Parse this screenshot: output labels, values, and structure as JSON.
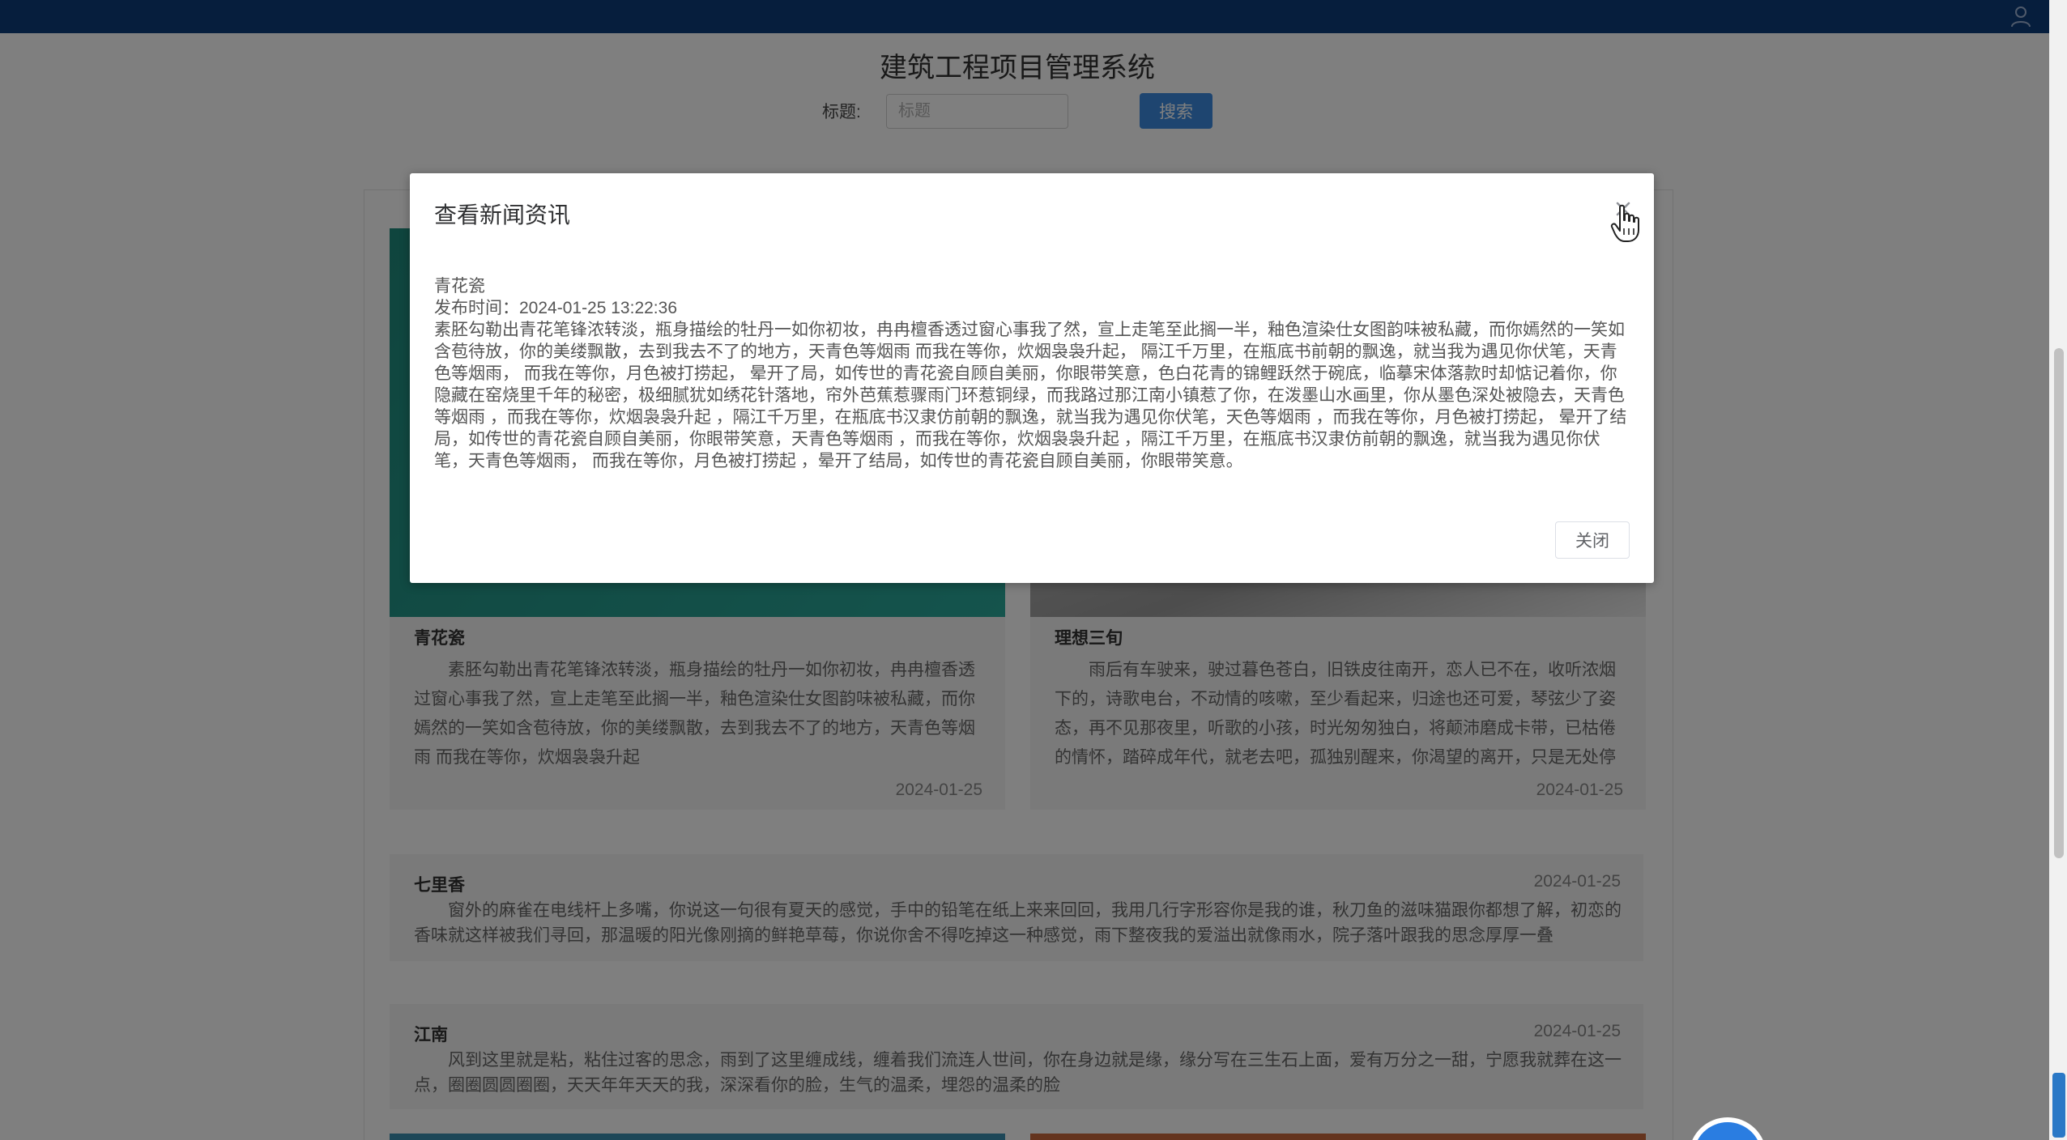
{
  "header": {
    "user_icon": "user-icon"
  },
  "page": {
    "title": "建筑工程项目管理系统",
    "search_label": "标题:",
    "search_placeholder": "标题",
    "search_button": "搜索"
  },
  "cards": [
    {
      "title": "青花瓷",
      "summary": "素胚勾勒出青花笔锋浓转淡，瓶身描绘的牡丹一如你初妆，冉冉檀香透过窗心事我了然，宣上走笔至此搁一半，釉色渲染仕女图韵味被私藏，而你嫣然的一笑如含苞待放，你的美缕飘散，去到我去不了的地方，天青色等烟雨 而我在等你，炊烟袅袅升起",
      "date": "2024-01-25"
    },
    {
      "title": "理想三旬",
      "summary": "雨后有车驶来，驶过暮色苍白，旧铁皮往南开，恋人已不在，收听浓烟下的，诗歌电台，不动情的咳嗽，至少看起来，归途也还可爱，琴弦少了姿态，再不见那夜里，听歌的小孩，时光匆匆独白，将颠沛磨成卡带，已枯倦的情怀，踏碎成年代，就老去吧，孤独别醒来，你渴望的离开，只是无处停",
      "date": "2024-01-25"
    }
  ],
  "rows": [
    {
      "title": "七里香",
      "date": "2024-01-25",
      "summary": "窗外的麻雀在电线杆上多嘴，你说这一句很有夏天的感觉，手中的铅笔在纸上来来回回，我用几行字形容你是我的谁，秋刀鱼的滋味猫跟你都想了解，初恋的香味就这样被我们寻回，那温暖的阳光像刚摘的鲜艳草莓，你说你舍不得吃掉这一种感觉，雨下整夜我的爱溢出就像雨水，院子落叶跟我的思念厚厚一叠"
    },
    {
      "title": "江南",
      "date": "2024-01-25",
      "summary": "风到这里就是粘，粘住过客的思念，雨到了这里缠成线，缠着我们流连人世间，你在身边就是缘，缘分写在三生石上面，爱有万分之一甜，宁愿我就葬在这一点，圈圈圆圆圈圈，天天年年天天的我，深深看你的脸，生气的温柔，埋怨的温柔的脸"
    }
  ],
  "dialog": {
    "title": "查看新闻资讯",
    "news_title": "青花瓷",
    "publish_time": "发布时间：2024-01-25 13:22:36",
    "content": "素胚勾勒出青花笔锋浓转淡，瓶身描绘的牡丹一如你初妆，冉冉檀香透过窗心事我了然，宣上走笔至此搁一半，釉色渲染仕女图韵味被私藏，而你嫣然的一笑如含苞待放，你的美缕飘散，去到我去不了的地方，天青色等烟雨 而我在等你，炊烟袅袅升起， 隔江千万里，在瓶底书前朝的飘逸，就当我为遇见你伏笔，天青色等烟雨， 而我在等你，月色被打捞起， 晕开了局，如传世的青花瓷自顾自美丽，你眼带笑意，色白花青的锦鲤跃然于碗底，临摹宋体落款时却惦记着你，你隐藏在窑烧里千年的秘密，极细腻犹如绣花针落地，帘外芭蕉惹骤雨门环惹铜绿，而我路过那江南小镇惹了你，在泼墨山水画里，你从墨色深处被隐去，天青色等烟雨 ，而我在等你，炊烟袅袅升起 ，隔江千万里，在瓶底书汉隶仿前朝的飘逸，就当我为遇见你伏笔，天色等烟雨 ，而我在等你，月色被打捞起， 晕开了结局，如传世的青花瓷自顾自美丽，你眼带笑意，天青色等烟雨 ，而我在等你，炊烟袅袅升起 ，隔江千万里，在瓶底书汉隶仿前朝的飘逸，就当我为遇见你伏笔，天青色等烟雨， 而我在等你，月色被打捞起 ，晕开了结局，如传世的青花瓷自顾自美丽，你眼带笑意。",
    "close_button": "关闭",
    "close_icon": "close-icon"
  },
  "colors": {
    "topbar": "#0d3c7a",
    "primary": "#3d8be0"
  }
}
